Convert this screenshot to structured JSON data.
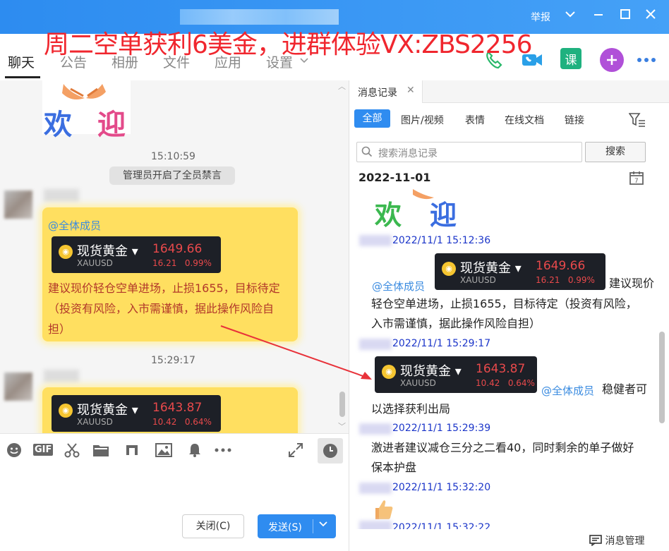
{
  "window": {
    "report_label": "举报",
    "promo_overlay": "周二空单获利6美金，进群体验VX:ZBS2256"
  },
  "tabs": [
    {
      "label": "聊天"
    },
    {
      "label": "公告"
    },
    {
      "label": "相册"
    },
    {
      "label": "文件"
    },
    {
      "label": "应用"
    },
    {
      "label": "设置"
    }
  ],
  "header_icons": {
    "course_label": "课"
  },
  "chat": {
    "welcome_chars": [
      "欢",
      "迎"
    ],
    "time1": "15:10:59",
    "system_notice": "管理员开启了全员禁言",
    "msg1": {
      "mention": "@全体成员",
      "card": {
        "name": "现货黄金",
        "code": "XAUUSD",
        "price": "1649.66",
        "change": "16.21",
        "pct": "0.99%"
      },
      "text_line1": "建议现价轻仓空单进场，止损1655，目标待定",
      "text_line2": "（投资有风险，入市需谨慎，据此操作风险自",
      "text_line3": "担）"
    },
    "time2": "15:29:17",
    "msg2": {
      "card": {
        "name": "现货黄金",
        "code": "XAUUSD",
        "price": "1643.87",
        "change": "10.42",
        "pct": "0.64%"
      }
    }
  },
  "toolbar": {
    "gif_label": "GIF",
    "close_label": "关闭(C)",
    "send_label": "发送(S)"
  },
  "history": {
    "tab_label": "消息记录",
    "filters": [
      "全部",
      "图片/视频",
      "表情",
      "在线文档",
      "链接"
    ],
    "search_placeholder": "搜索消息记录",
    "search_button": "搜索",
    "date": "2022-11-01",
    "welcome_chars": [
      "欢",
      "迎"
    ],
    "entries": [
      {
        "time": "2022/11/1 15:12:36"
      },
      {
        "time": "2022/11/1 15:29:17"
      },
      {
        "time": "2022/11/1 15:29:39"
      },
      {
        "time": "2022/11/1 15:32:20"
      },
      {
        "time": "2022/11/1 15:32:22"
      }
    ],
    "entry1": {
      "mention": "@全体成员",
      "card": {
        "name": "现货黄金",
        "code": "XAUUSD",
        "price": "1649.66",
        "change": "16.21",
        "pct": "0.99%"
      },
      "text_tail": "建议现价",
      "text_line2": "轻仓空单进场，止损1655，目标待定（投资有风险，",
      "text_line3": "入市需谨慎，据此操作风险自担）"
    },
    "entry2": {
      "card": {
        "name": "现货黄金",
        "code": "XAUUSD",
        "price": "1643.87",
        "change": "10.42",
        "pct": "0.64%"
      },
      "mention": "@全体成员",
      "text_tail": "稳健者可",
      "text_line2": "以选择获利出局"
    },
    "entry3": {
      "text_line1": "激进者建议减仓三分之二看40，同时剩余的单子做好",
      "text_line2": "保本护盘"
    },
    "footer_label": "消息管理"
  },
  "colors": {
    "titlebar": "#2d8cf0",
    "promo": "#f0262e",
    "bubble": "#ffdf60",
    "price_red": "#e8494b",
    "link_blue": "#1b35c9"
  }
}
